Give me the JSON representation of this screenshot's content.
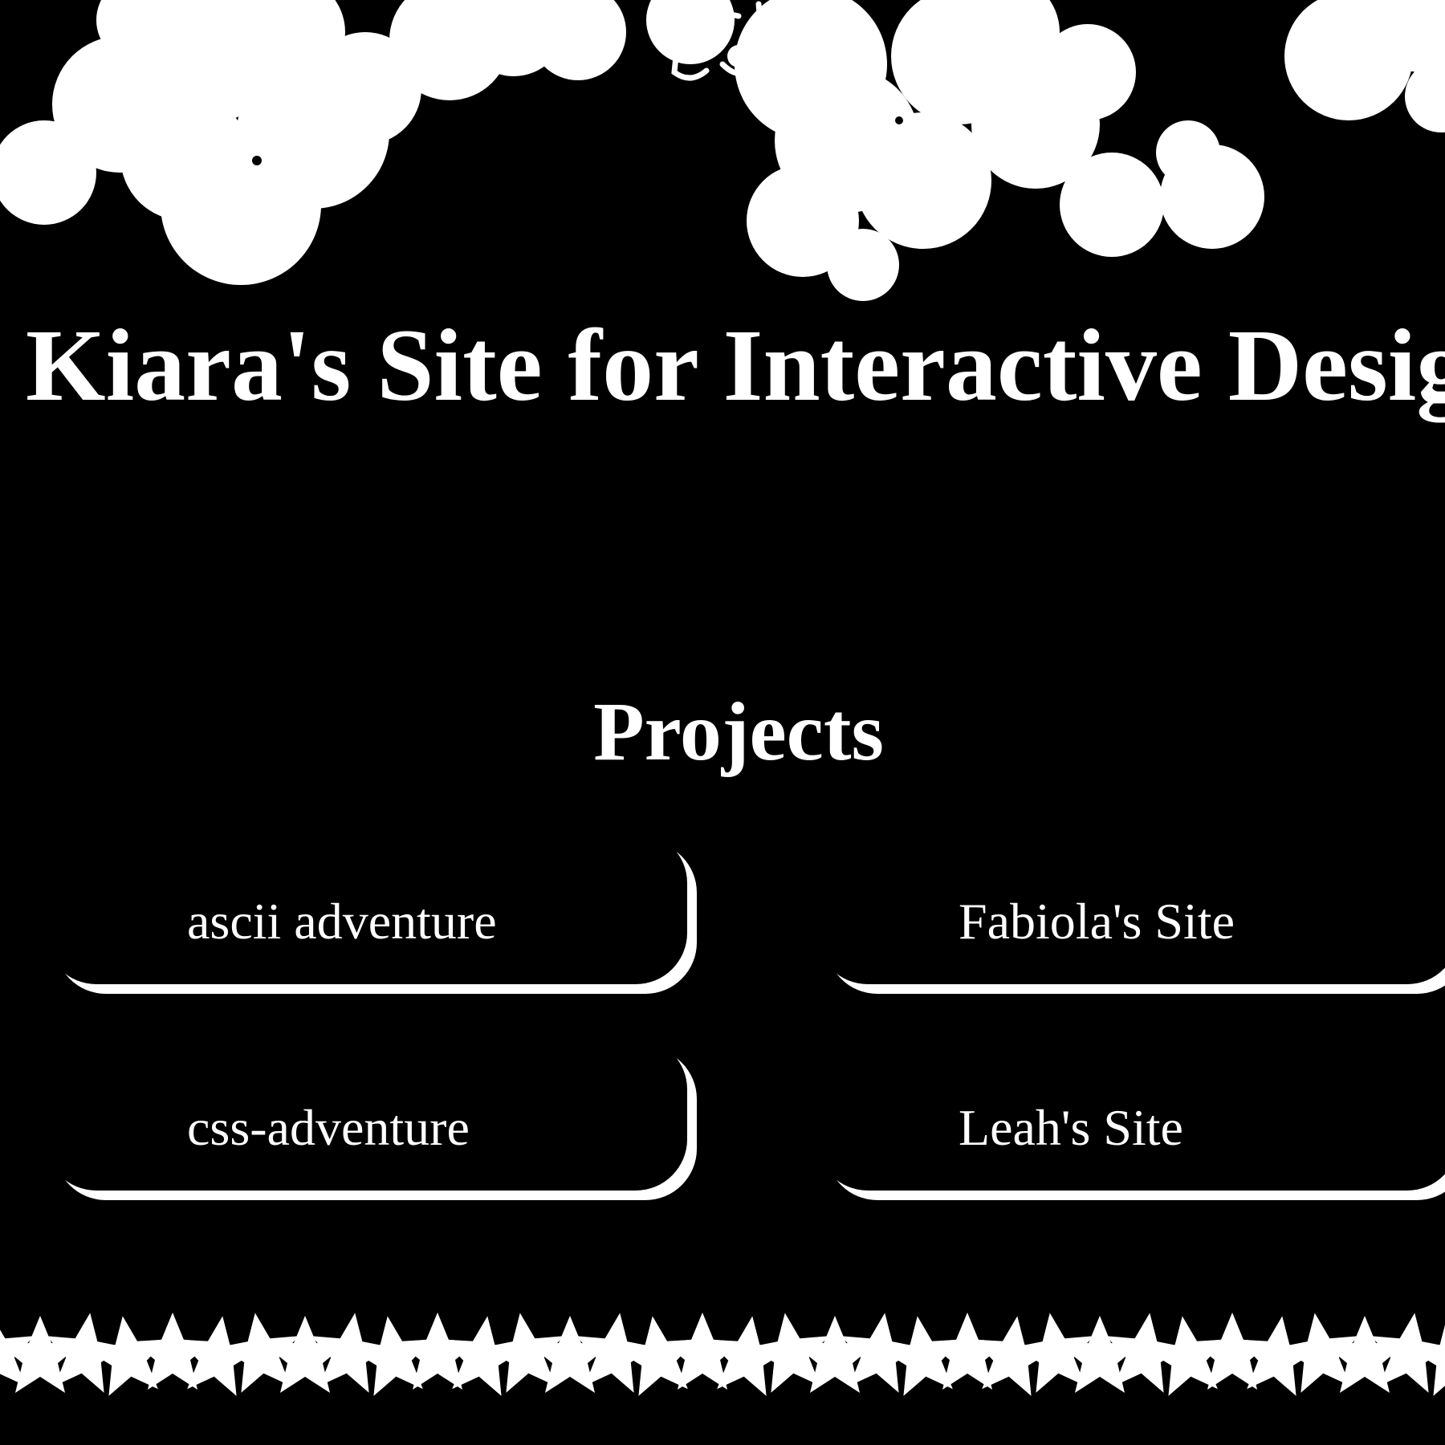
{
  "header": {
    "title": "Kiara's Site for Interactive Design"
  },
  "projects": {
    "heading": "Projects",
    "items": [
      {
        "label": "ascii adventure"
      },
      {
        "label": "Fabiola's Site"
      },
      {
        "label": "css-adventure"
      },
      {
        "label": "Leah's Site"
      }
    ]
  },
  "decorations": {
    "top": "blossom-cluster",
    "bottom": "star-border"
  },
  "colors": {
    "background": "#000000",
    "foreground": "#ffffff"
  }
}
